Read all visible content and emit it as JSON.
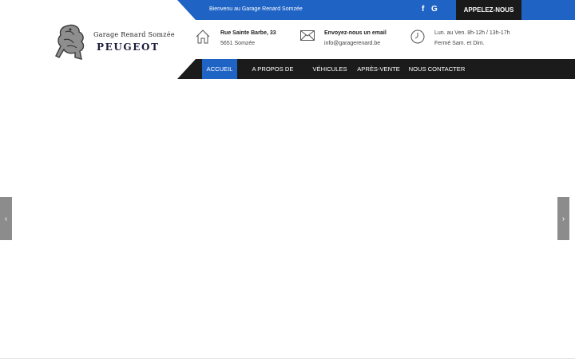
{
  "topbar": {
    "welcome": "Bienvenu au Garage Renard Somzée",
    "social": [
      "facebook-icon",
      "google-icon"
    ],
    "social_glyphs": [
      "f",
      "G"
    ],
    "call_label": "APPELEZ-NOUS"
  },
  "logo": {
    "brand": "Garage Renard Somzée",
    "name": "PEUGEOT"
  },
  "info": {
    "address": {
      "title": "Rue Sainte Barbe, 33",
      "sub": "5651 Somzée"
    },
    "email": {
      "title": "Envoyez-nous un email",
      "sub": "info@garagerenard.be"
    },
    "hours": {
      "line1": "Lun. au Ven. 8h-12h / 13h-17h",
      "line2": "Fermé Sam. et Dim."
    }
  },
  "nav": [
    "ACCUEIL",
    "A PROPOS DE NOUS",
    "VÉHICULES",
    "APRÈS-VENTE",
    "NOUS CONTACTER"
  ],
  "slider": {
    "prev": "‹",
    "next": "›"
  },
  "colors": {
    "accent": "#1f63c5",
    "dark": "#1b1b1b"
  }
}
